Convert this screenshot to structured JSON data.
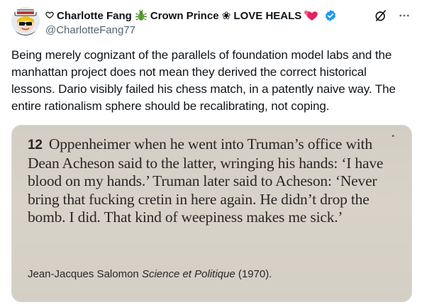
{
  "author": {
    "display_name": "Charlotte Fang",
    "name_suffix": "Crown Prince ❀ LOVE HEALS",
    "handle": "@CharlotteFang77"
  },
  "tweet": {
    "text": "Being merely cognizant of the parallels of foundation model labs and the manhattan project does not mean they derived the correct historical lessons. Dario visibly failed his chess match, in a patently naive way. The entire rationalism sphere should be recalibrating, not coping."
  },
  "media": {
    "footnote_number": "12",
    "quote": "Oppenheimer when he went into Truman’s office with Dean Acheson said to the latter, wringing his hands: ‘I have blood on my hands.’ Truman later said to Acheson: ‘Never bring that fucking cretin in here again. He didn’t drop the bomb. I did. That kind of weepiness makes me sick.’",
    "citation_author": "Jean-Jacques Salomon",
    "citation_title": "Science et Politique",
    "citation_year": "(1970).",
    "page_mark": "•"
  },
  "icons": {
    "heart": "heart-outline-icon",
    "bug": "bug-emoji-icon",
    "hearts": "two-hearts-emoji-icon",
    "verified": "verified-badge-icon",
    "grok": "grok-icon",
    "more": "more-options-icon"
  },
  "colors": {
    "verified": "#1d9bf0",
    "text": "#0f1419",
    "secondary": "#536471"
  }
}
